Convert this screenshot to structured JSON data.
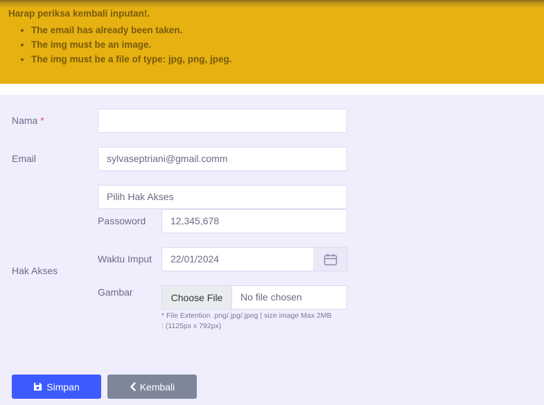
{
  "alert": {
    "title": "Harap periksa kembali inputan!.",
    "errors": [
      "The email has already been taken.",
      "The img must be an image.",
      "The img must be a file of type: jpg, png, jpeg."
    ]
  },
  "form": {
    "nama_label": "Nama",
    "required_mark": "*",
    "nama_value": "",
    "email_label": "Email",
    "email_value": "sylvaseptriani@gmail.comm",
    "hak_akses_label": "Hak Akses",
    "hak_akses_value": "Pilih Hak Akses",
    "password_label": "Passoword",
    "password_value": "12,345,678",
    "waktu_label": "Waktu Imput",
    "waktu_value": "22/01/2024",
    "gambar_label": "Gambar",
    "file_button": "Choose File",
    "file_status": "No file chosen",
    "file_hint_line1": "* File Extention .png/.jpg/.jpeg | size image Max 2MB",
    "file_hint_line2": ": (1125px x 792px)"
  },
  "buttons": {
    "save_label": "Simpan",
    "back_label": "Kembali"
  },
  "colors": {
    "alert_bg": "#e6b111",
    "save_btn": "#3d5afe",
    "back_btn": "#7d8799",
    "page_bg": "#f0eefd"
  },
  "icons": {
    "save": "floppy-disk-icon",
    "back": "chevron-left-icon",
    "calendar": "calendar-icon"
  }
}
